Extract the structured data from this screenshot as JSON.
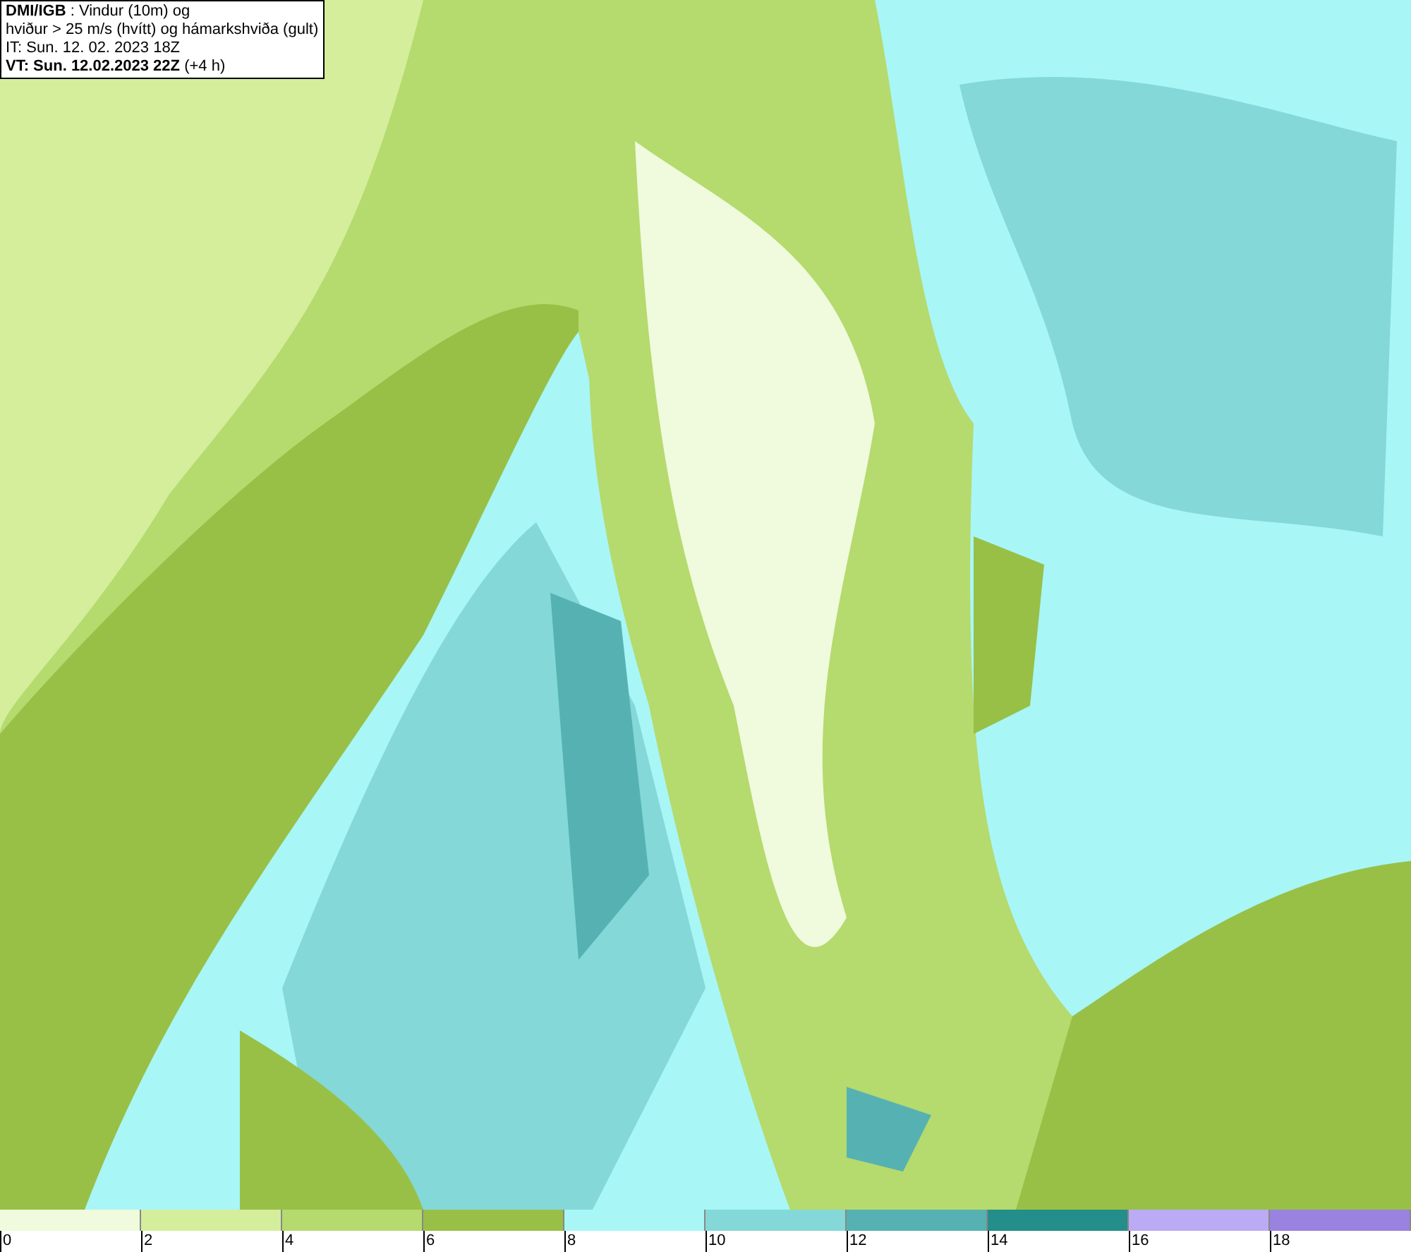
{
  "info_box": {
    "lines": [
      "**DMI/IGB** : Vindur (10m) og",
      "hviður > 25 m/s (hvítt) og hámarkshviða (gult)",
      "IT: Sun. 12. 02. 2023 18Z",
      "**VT: Sun. 12.02.2023 22Z** (+4 h)"
    ]
  },
  "legend": {
    "bins": [
      {
        "color": "#f0fadc"
      },
      {
        "color": "#d4ee9c"
      },
      {
        "color": "#b5da6e"
      },
      {
        "color": "#98c047"
      },
      {
        "color": "#a8f6f6"
      },
      {
        "color": "#84d8d8"
      },
      {
        "color": "#56b2b2"
      },
      {
        "color": "#248e8a"
      },
      {
        "color": "#bbaaf4"
      },
      {
        "color": "#9a82e0"
      }
    ],
    "ticks": [
      "0",
      "2",
      "4",
      "6",
      "8",
      "10",
      "12",
      "14",
      "16",
      "18"
    ]
  }
}
